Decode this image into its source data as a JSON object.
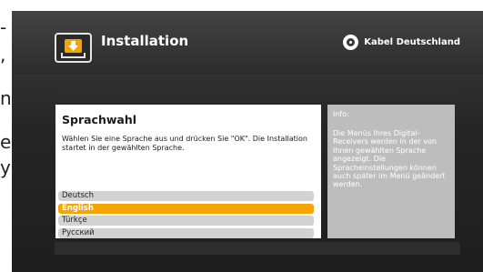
{
  "left_edge_fragments": [
    "-",
    ",",
    "n",
    "e",
    "y"
  ],
  "header": {
    "title": "Installation",
    "brand_name": "Kabel Deutschland",
    "accent_color": "#f6a500"
  },
  "main": {
    "title": "Sprachwahl",
    "description": "Wählen Sie eine Sprache aus und drücken Sie \"OK\". Die Installation startet in der gewählten Sprache.",
    "languages": [
      {
        "label": "Deutsch",
        "selected": false
      },
      {
        "label": "English",
        "selected": true
      },
      {
        "label": "Türkçe",
        "selected": false
      },
      {
        "label": "Русский",
        "selected": false
      }
    ]
  },
  "info": {
    "heading": "Info:",
    "text": "Die Menüs Ihres Digital-Receivers werden in der von Ihnen gewählten Sprache angezeigt. Die Spracheinstellungen können auch später im Menü geändert werden."
  },
  "icons": {
    "app": "download-install-icon",
    "brand": "kabel-deutschland-logo-icon"
  }
}
